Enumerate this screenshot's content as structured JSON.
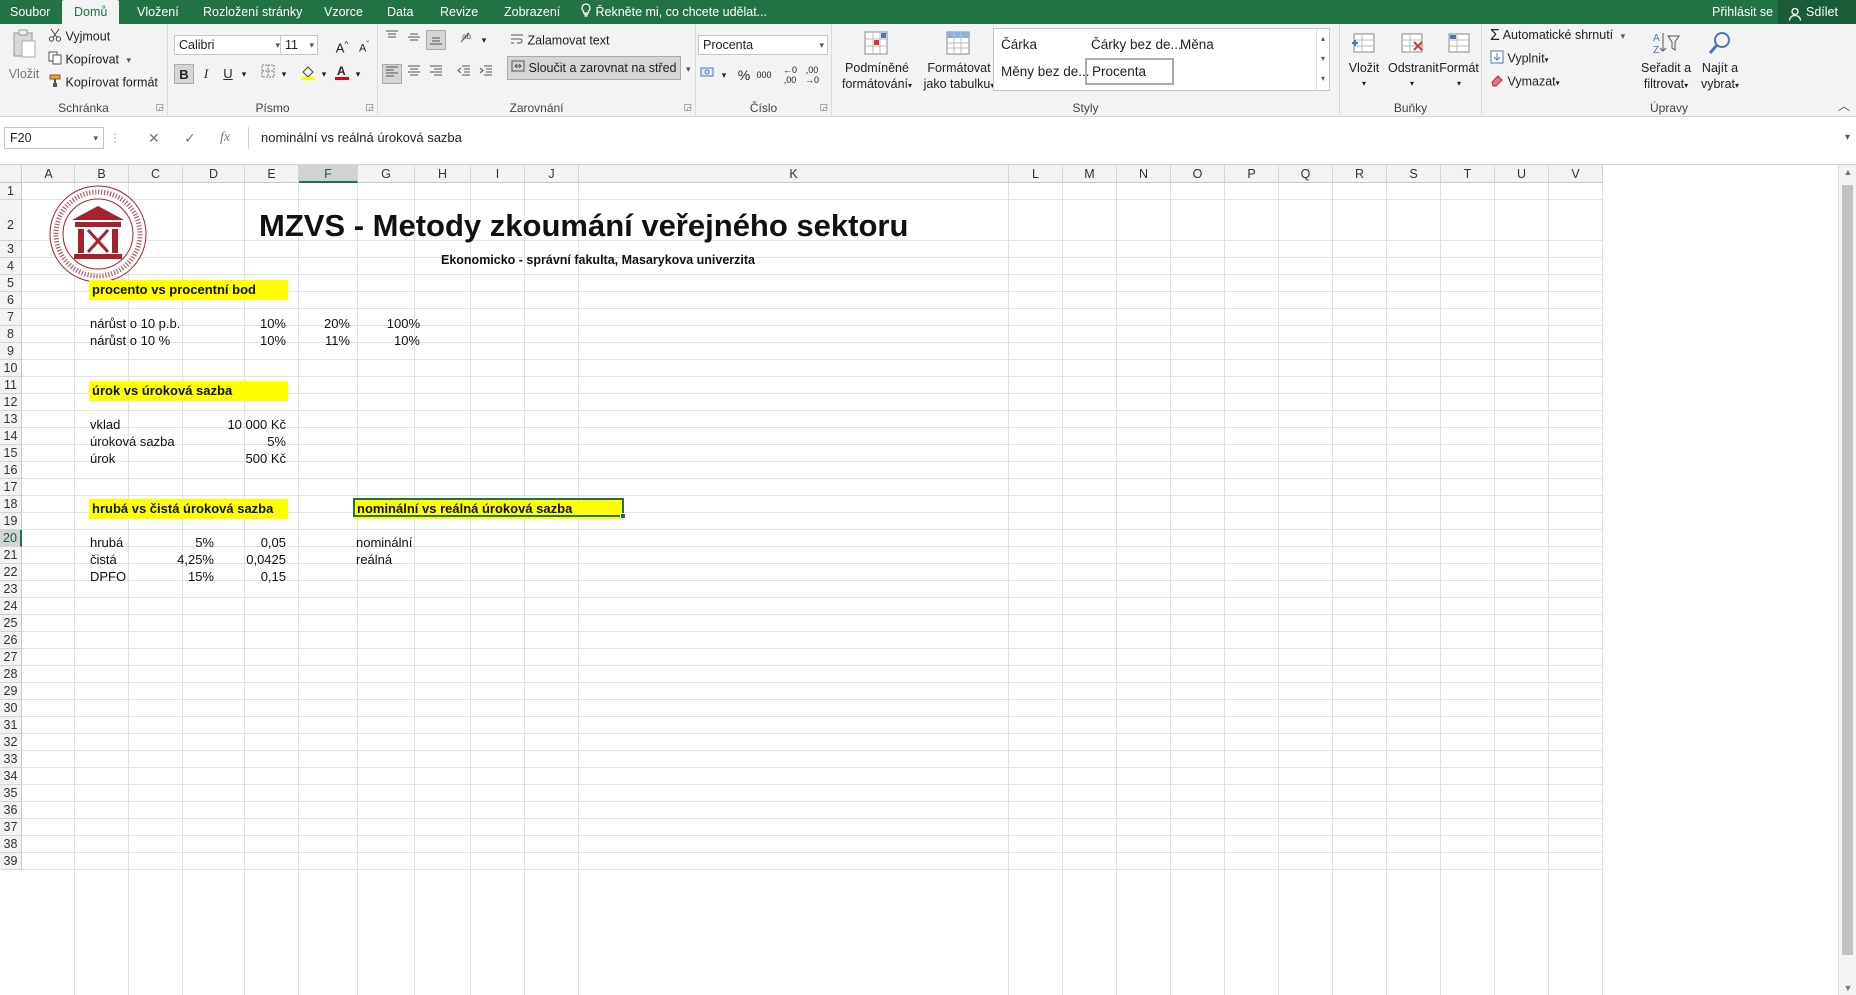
{
  "tabs": {
    "file": "Soubor",
    "home": "Domů",
    "insert": "Vložení",
    "layout": "Rozložení stránky",
    "formulas": "Vzorce",
    "data": "Data",
    "review": "Revize",
    "view": "Zobrazení",
    "tell_me": "Řekněte mi, co chcete udělat...",
    "sign_in": "Přihlásit se",
    "share": "Sdílet"
  },
  "ribbon": {
    "clipboard": {
      "label": "Schránka",
      "paste": "Vložit",
      "cut": "Vyjmout",
      "copy": "Kopírovat",
      "format_painter": "Kopírovat formát"
    },
    "font": {
      "label": "Písmo",
      "name": "Calibri",
      "size": "11",
      "bold": "B",
      "italic": "I",
      "underline": "U"
    },
    "alignment": {
      "label": "Zarovnání",
      "wrap_text": "Zalamovat text",
      "merge_center": "Sloučit a zarovnat na střed"
    },
    "number": {
      "label": "Číslo",
      "format": "Procenta",
      "percent": "%",
      "thousands": "000"
    },
    "styles": {
      "label": "Styly",
      "conditional_1": "Podmíněné",
      "conditional_2": "formátování",
      "format_table_1": "Formátovat",
      "format_table_2": "jako tabulku",
      "items": [
        "Čárka",
        "Čárky bez de...",
        "Měna",
        "Měny bez de...",
        "Procenta"
      ]
    },
    "cells": {
      "label": "Buňky",
      "insert": "Vložit",
      "delete": "Odstranit",
      "format": "Formát"
    },
    "editing": {
      "label": "Úpravy",
      "autosum": "Automatické shrnutí",
      "fill": "Vyplnit",
      "clear": "Vymazat",
      "sort_1": "Seřadit a",
      "sort_2": "filtrovat",
      "find_1": "Najít a",
      "find_2": "vybrat"
    }
  },
  "formula_bar": {
    "name_box": "F20",
    "cancel": "✕",
    "enter": "✓",
    "fx": "fx",
    "content": "nominální vs reálná úroková sazba"
  },
  "columns": [
    "A",
    "B",
    "C",
    "D",
    "E",
    "F",
    "G",
    "H",
    "I",
    "J",
    "K",
    "L",
    "M",
    "N",
    "O",
    "P",
    "Q",
    "R",
    "S",
    "T",
    "U",
    "V"
  ],
  "selected_column": "F",
  "selected_row": 20,
  "sheet": {
    "title": "MZVS - Metody zkoumání veřejného sektoru",
    "subtitle": "Ekonomicko - správní fakulta, Masarykova univerzita",
    "logo_text": "UNIVERSITAS MASARYKIANA BRUNENSIS · FACULTAS RERUM OECONOMICARUM",
    "sec1": {
      "header": "procento vs procentní bod",
      "r9_label": "nárůst o  10 p.b.",
      "r9_d": "10%",
      "r9_e": "20%",
      "r9_f": "100%",
      "r10_label": "nárůst  o  10 %",
      "r10_d": "10%",
      "r10_e": "11%",
      "r10_f": "10%"
    },
    "sec2": {
      "header": "úrok vs úroková sazba",
      "deposit_label": "vklad",
      "deposit_value": "10 000 Kč",
      "rate_label": "úroková sazba",
      "rate_value": "5%",
      "interest_label": "úrok",
      "interest_value": "500 Kč"
    },
    "sec3": {
      "header": "hrubá vs čistá úroková sazba",
      "gross_label": "hrubá",
      "gross_c": "5%",
      "gross_d": "0,05",
      "net_label": "čistá",
      "net_c": "4,25%",
      "net_d": "0,0425",
      "tax_label": "DPFO",
      "tax_c": "15%",
      "tax_d": "0,15"
    },
    "sec4": {
      "header": "nominální vs reálná úroková sazba",
      "nominal_label": "nominální",
      "real_label": "reálná"
    }
  },
  "colors": {
    "excel_green": "#217346",
    "highlight_yellow": "#ffff00",
    "logo_red": "#a3222c"
  }
}
